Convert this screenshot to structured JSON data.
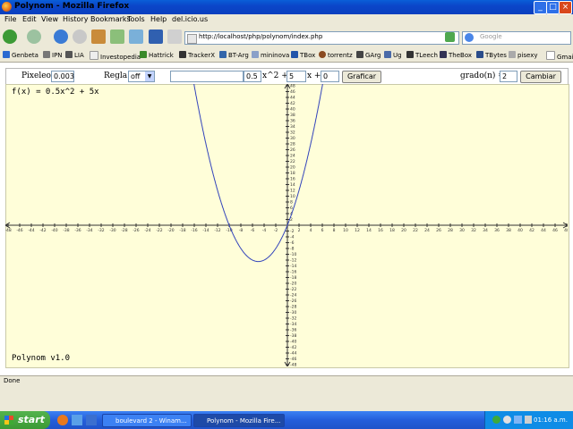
{
  "window": {
    "title": "Polynom - Mozilla Firefox"
  },
  "menu": [
    "File",
    "Edit",
    "View",
    "History",
    "Bookmarks",
    "Tools",
    "Help",
    "del.icio.us"
  ],
  "nav": {
    "url": "http://localhost/php/polynom/index.php",
    "search_placeholder": "Google"
  },
  "bookmarks": [
    "Genbeta",
    "IPN",
    "LIA",
    "Investopedia",
    "Hattrick",
    "TrackerX",
    "BT-Arg",
    "mininova",
    "TBox",
    "torrentz",
    "GArg",
    "Ug",
    "TLeech",
    "TheBox",
    "TBytes",
    "pisexy",
    "Gmail"
  ],
  "form": {
    "pixeleo_label": "Pixeleo:",
    "pixeleo_value": "0.003",
    "regla_label": "Regla:",
    "regla_value": "off",
    "coef_a": "0.5",
    "term_a": "x^2 +",
    "coef_b": "5",
    "term_b": "x +",
    "coef_c": "0",
    "graficar_label": "Graficar",
    "grado_label": "grado(n) =",
    "grado_value": "2",
    "cambiar_label": "Cambiar"
  },
  "plot": {
    "function_label": "f(x) = 0.5x^2 + 5x",
    "app_label": "Polynom v1.0",
    "curve_color": "#3344bb",
    "polynomial": {
      "a": 0.5,
      "b": 5,
      "c": 0
    },
    "x_range": [
      -48,
      48
    ],
    "y_range": [
      -48,
      48
    ],
    "tick_step": 2
  },
  "status": {
    "text": "Done"
  },
  "taskbar": {
    "start_label": "start",
    "tasks": [
      "boulevard 2 - Winam...",
      "Polynom - Mozilla Fire..."
    ],
    "clock": "01:16 a.m."
  }
}
